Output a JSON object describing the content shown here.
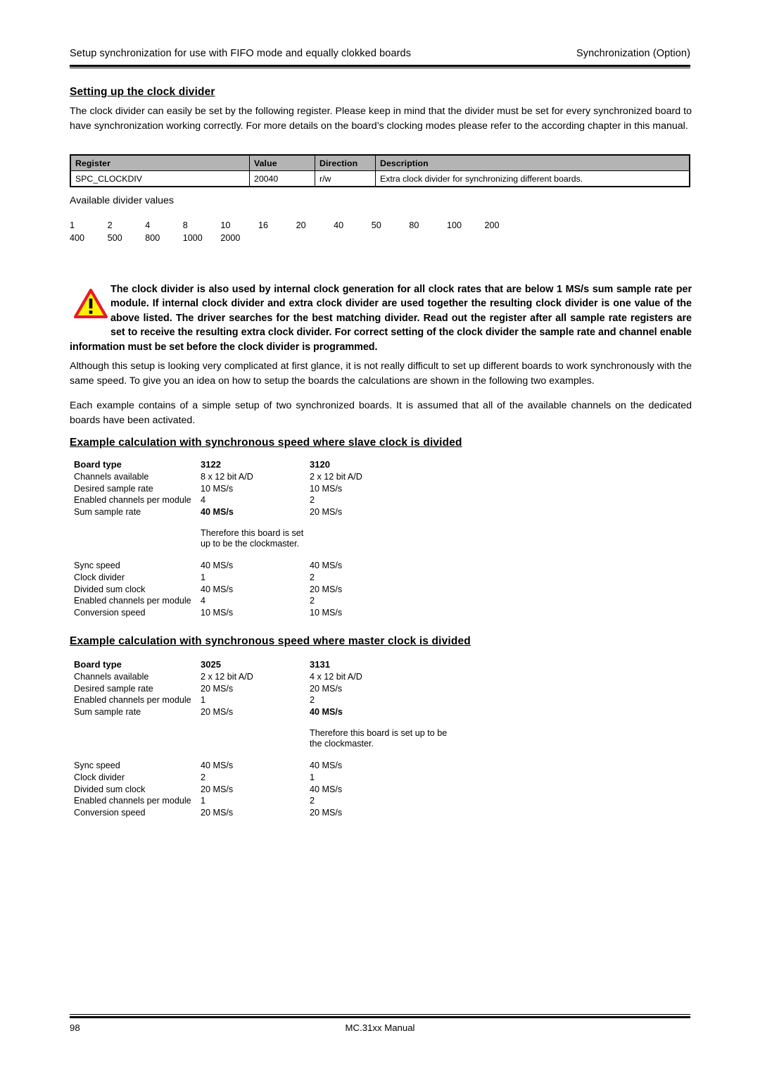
{
  "header": {
    "left": "Setup synchronization for use with FIFO mode and equally clokked boards",
    "right": "Synchronization (Option)"
  },
  "sections": {
    "clock_divider": {
      "heading": "Setting up the clock divider",
      "intro": "The clock divider can easily be set by the following register. Please keep in mind that the divider must be set for every synchronized board to have synchronization working correctly. For more details on the board’s clocking modes please refer to the according chapter in this manual."
    },
    "slave_example": {
      "heading": "Example calculation with synchronous speed where slave clock is divided"
    },
    "master_example": {
      "heading": "Example calculation with synchronous speed where master clock is divided"
    }
  },
  "register_table": {
    "columns": [
      "Register",
      "Value",
      "Direction",
      "Description"
    ],
    "rows": [
      {
        "register": "SPC_CLOCKDIV",
        "value": "20040",
        "direction": "r/w",
        "description": "Extra clock divider for synchronizing different boards."
      }
    ],
    "header_bg": "#b4b4b4"
  },
  "divider_values": {
    "label": "Available divider values",
    "row1": [
      "1",
      "2",
      "4",
      "8",
      "10",
      "16",
      "20",
      "40",
      "50",
      "80",
      "100",
      "200"
    ],
    "row2": [
      "400",
      "500",
      "800",
      "1000",
      "2000"
    ]
  },
  "warning": {
    "icon": "warning-triangle-icon",
    "icon_fill": "#FFF200",
    "icon_stroke": "#E8192C",
    "text": "The clock divider is also used by internal clock generation for all clock rates that are below 1 MS/s sum sample rate per module. If internal clock divider and extra clock divider are used together the resulting clock divider is one value of the above listed. The driver searches for the best matching divider. Read out the register after all sample rate registers are set to receive the resulting extra clock divider. For correct setting of the clock divider the sample rate and channel enable information must be set before the clock divider is programmed."
  },
  "paragraphs": {
    "p1": "Although this setup is looking very complicated at first glance, it is not really difficult to set up different boards to work synchronously with the same speed. To give you an idea on how to setup the boards the calculations are shown in the following two examples.",
    "p2": "Each example contains of a simple setup of two synchronized boards. It is assumed that all of the available channels on the dedicated boards have been activated."
  },
  "example1": {
    "header": [
      "Board type",
      "3122",
      "3120"
    ],
    "rows": [
      {
        "label": "Channels available",
        "a": "8 x 12 bit A/D",
        "b": "2 x 12 bit A/D",
        "a_bold": false,
        "b_bold": false
      },
      {
        "label": "Desired sample rate",
        "a": "10 MS/s",
        "b": "10 MS/s",
        "a_bold": false,
        "b_bold": false
      },
      {
        "label": "Enabled channels per module",
        "a": "4",
        "b": "2",
        "a_bold": false,
        "b_bold": false
      },
      {
        "label": "Sum sample rate",
        "a": "40 MS/s",
        "b": "20 MS/s",
        "a_bold": true,
        "b_bold": false
      }
    ],
    "note": "Therefore this board is set up to be the clockmaster.",
    "note_column": "a",
    "rows2": [
      {
        "label": "Sync speed",
        "a": "40 MS/s",
        "b": "40 MS/s"
      },
      {
        "label": "Clock divider",
        "a": "1",
        "b": "2"
      },
      {
        "label": "Divided sum clock",
        "a": "40 MS/s",
        "b": "20 MS/s"
      },
      {
        "label": "Enabled channels per module",
        "a": "4",
        "b": "2"
      },
      {
        "label": "Conversion speed",
        "a": "10 MS/s",
        "b": "10 MS/s"
      }
    ]
  },
  "example2": {
    "header": [
      "Board type",
      "3025",
      "3131"
    ],
    "rows": [
      {
        "label": "Channels available",
        "a": "2 x 12 bit A/D",
        "b": "4 x 12 bit A/D",
        "a_bold": false,
        "b_bold": false
      },
      {
        "label": "Desired sample rate",
        "a": "20 MS/s",
        "b": "20 MS/s",
        "a_bold": false,
        "b_bold": false
      },
      {
        "label": "Enabled channels per module",
        "a": "1",
        "b": "2",
        "a_bold": false,
        "b_bold": false
      },
      {
        "label": "Sum sample rate",
        "a": "20 MS/s",
        "b": "40 MS/s",
        "a_bold": false,
        "b_bold": true
      }
    ],
    "note": "Therefore this board is set up to be the clockmaster.",
    "note_column": "b",
    "rows2": [
      {
        "label": "Sync speed",
        "a": "40 MS/s",
        "b": "40 MS/s"
      },
      {
        "label": "Clock divider",
        "a": "2",
        "b": "1"
      },
      {
        "label": "Divided sum clock",
        "a": "20 MS/s",
        "b": "40 MS/s"
      },
      {
        "label": "Enabled channels per module",
        "a": "1",
        "b": "2"
      },
      {
        "label": "Conversion speed",
        "a": "20 MS/s",
        "b": "20 MS/s"
      }
    ]
  },
  "footer": {
    "page_number": "98",
    "title": "MC.31xx Manual"
  }
}
